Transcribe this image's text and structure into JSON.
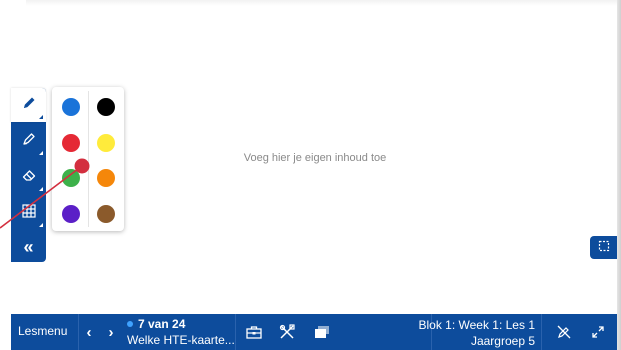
{
  "board": {
    "placeholder": "Voeg hier je eigen inhoud toe"
  },
  "toolbar": {
    "tools": [
      {
        "name": "pen",
        "icon": "pen-icon",
        "active": true
      },
      {
        "name": "highlighter",
        "icon": "highlighter-icon",
        "active": false
      },
      {
        "name": "eraser",
        "icon": "eraser-icon",
        "active": false
      },
      {
        "name": "grid",
        "icon": "grid-icon",
        "active": false
      },
      {
        "name": "collapse",
        "icon": "double-chevron-left-icon",
        "active": false
      }
    ],
    "collapse_label": "«"
  },
  "palette": {
    "colors": [
      {
        "name": "blue",
        "hex": "#1a73d9"
      },
      {
        "name": "black",
        "hex": "#000000"
      },
      {
        "name": "red",
        "hex": "#e52935"
      },
      {
        "name": "yellow",
        "hex": "#ffeb3b"
      },
      {
        "name": "green",
        "hex": "#3db14a"
      },
      {
        "name": "orange",
        "hex": "#f5870a"
      },
      {
        "name": "purple",
        "hex": "#5b1fc7"
      },
      {
        "name": "brown",
        "hex": "#8b5a2b"
      }
    ],
    "pointer_color": "#d32f3f"
  },
  "bottombar": {
    "lesmenu_label": "Lesmenu",
    "prev_label": "‹",
    "next_label": "›",
    "slide_position": "7 van 24",
    "slide_title": "Welke HTE-kaarte...",
    "lesson_line1": "Blok 1: Week 1: Les 1",
    "lesson_line2": "Jaargroep 5",
    "icons": [
      "toolbox-icon",
      "tools-icon",
      "windows-icon",
      "hide-annotations-icon",
      "expand-icon"
    ]
  },
  "colors": {
    "primary": "#0d4c9c",
    "white": "#ffffff"
  }
}
